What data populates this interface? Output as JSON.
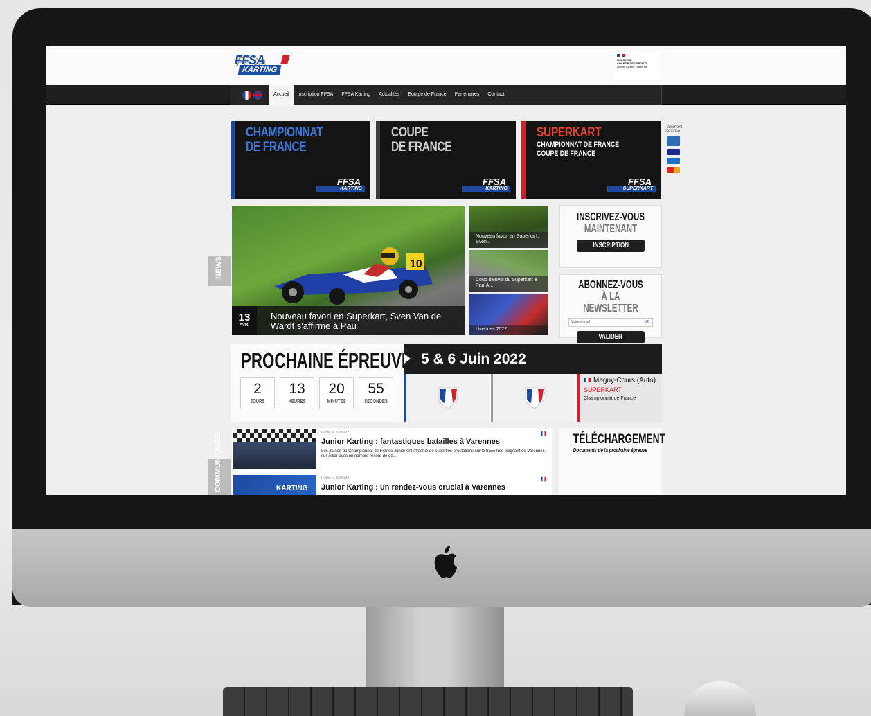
{
  "header": {
    "logo_top": "FFSA",
    "logo_bottom": "KARTING",
    "ministere_line1": "MINISTÈRE",
    "ministere_line2": "CHARGÉ DES SPORTS",
    "ministere_line3": "Liberté Égalité Fraternité"
  },
  "nav": {
    "items": [
      "Accueil",
      "Inscription FFSA",
      "FFSA Karting",
      "Actualités",
      "Equipe de France",
      "Partenaires",
      "Contact"
    ],
    "active_index": 0
  },
  "tiles": [
    {
      "line1": "CHAMPIONNAT",
      "line2": "DE FRANCE",
      "sub1": "",
      "sub2": "",
      "logo_top": "FFSA",
      "logo_bottom": "KARTING",
      "accent": "#1b4aa1"
    },
    {
      "line1": "COUPE",
      "line2": "DE FRANCE",
      "sub1": "",
      "sub2": "",
      "logo_top": "FFSA",
      "logo_bottom": "KARTING",
      "accent": "#3a3a3a"
    },
    {
      "line1": "SUPERKART",
      "line2": "",
      "sub1": "CHAMPIONNAT DE FRANCE",
      "sub2": "COUPE DE FRANCE",
      "logo_top": "FFSA",
      "logo_bottom": "SUPERKART",
      "accent": "#d4202a"
    }
  ],
  "payment": {
    "label1": "Paiement",
    "label2": "sécurisé"
  },
  "news": {
    "side_label": "NEWS",
    "hero": {
      "day": "13",
      "month": "AVR.",
      "title": "Nouveau favori en Superkart, Sven Van de Wardt s'affirme à Pau"
    },
    "thumbs": [
      "Nouveau favori en Superkart, Sven...",
      "Coup d'envoi du Superkart à Pau-A...",
      "Licences 2022"
    ]
  },
  "inscription": {
    "title1": "INSCRIVEZ-VOUS",
    "title2": "MAINTENANT",
    "button": "INSCRIPTION"
  },
  "newsletter": {
    "title1": "ABONNEZ-VOUS",
    "title2": "À LA NEWSLETTER",
    "placeholder": "Votre e-mail",
    "button": "VALIDER"
  },
  "prochaine": {
    "title": "PROCHAINE ÉPREUVE",
    "date": "5 & 6 Juin 2022",
    "countdown": [
      {
        "value": "2",
        "unit": "JOURS"
      },
      {
        "value": "13",
        "unit": "HEURES"
      },
      {
        "value": "20",
        "unit": "MINUTES"
      },
      {
        "value": "55",
        "unit": "SECONDES"
      }
    ],
    "place": "Magny-Cours (Auto)",
    "category": "SUPERKART",
    "championship": "Championnat de France"
  },
  "communiques": {
    "side_label": "COMMUNIQUÉS",
    "items": [
      {
        "published": "Publié le 29/05/22",
        "title": "Junior Karting : fantastiques batailles à Varennes",
        "text": "Les jeunes du Championnat de France Junior ont effectué de superbes prestations sur le tracé très exigeant de Varennes-sur-Allier avec un nombre record de dé..."
      },
      {
        "published": "Publié le 20/05/22",
        "title": "Junior Karting : un rendez-vous crucial à Varennes",
        "text": ""
      }
    ],
    "thumb_label": "KARTING"
  },
  "telechargement": {
    "title": "TÉLÉCHARGEMENT",
    "subtitle": "Documents de la prochaine épreuve"
  },
  "colors": {
    "blue": "#1b4aa1",
    "red": "#d4202a",
    "dark": "#1e1e1e"
  }
}
